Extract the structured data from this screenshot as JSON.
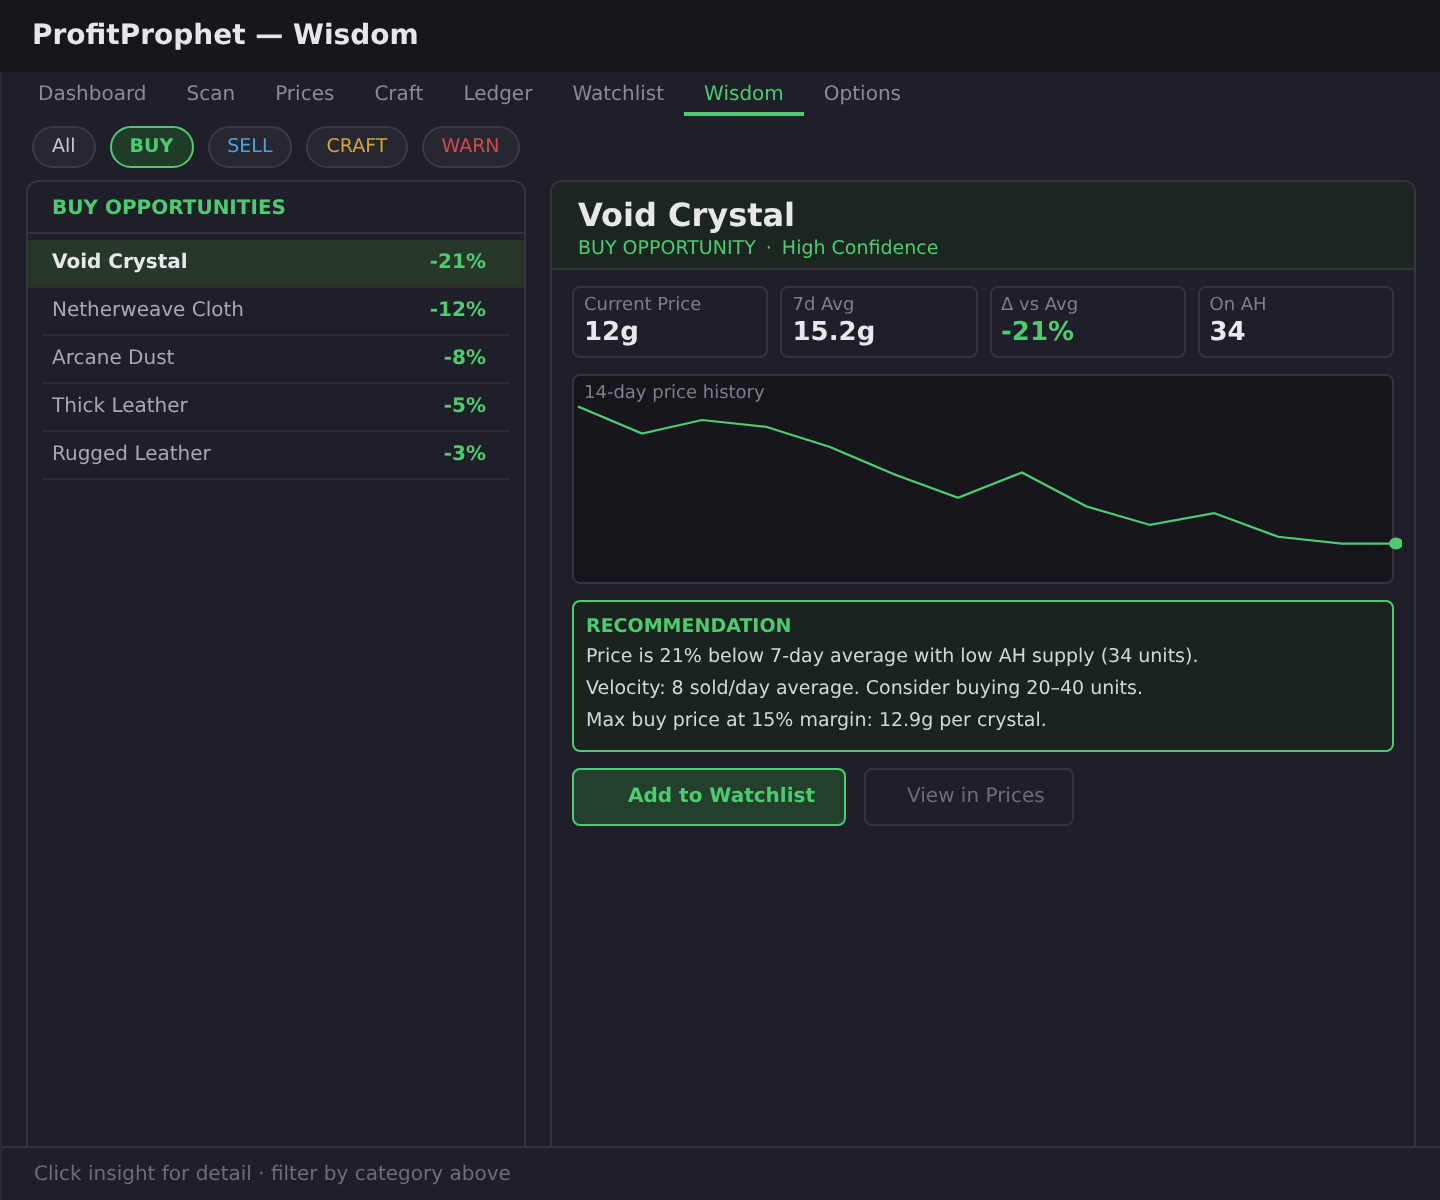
{
  "window": {
    "title": "ProfitProphet — Wisdom"
  },
  "tabs": [
    {
      "label": "Dashboard",
      "selected": false
    },
    {
      "label": "Scan",
      "selected": false
    },
    {
      "label": "Prices",
      "selected": false
    },
    {
      "label": "Craft",
      "selected": false
    },
    {
      "label": "Ledger",
      "selected": false
    },
    {
      "label": "Watchlist",
      "selected": false
    },
    {
      "label": "Wisdom",
      "selected": true
    },
    {
      "label": "Options",
      "selected": false
    }
  ],
  "filters": [
    {
      "label": "All",
      "kind": "all",
      "selected": false
    },
    {
      "label": "BUY",
      "kind": "buy",
      "selected": true
    },
    {
      "label": "SELL",
      "kind": "sell",
      "selected": false
    },
    {
      "label": "CRAFT",
      "kind": "craft",
      "selected": false
    },
    {
      "label": "WARN",
      "kind": "warn",
      "selected": false
    }
  ],
  "list": {
    "heading": "BUY OPPORTUNITIES",
    "items": [
      {
        "name": "Void Crystal",
        "change": "-21%",
        "selected": true
      },
      {
        "name": "Netherweave Cloth",
        "change": "-12%",
        "selected": false
      },
      {
        "name": "Arcane Dust",
        "change": "-8%",
        "selected": false
      },
      {
        "name": "Thick Leather",
        "change": "-5%",
        "selected": false
      },
      {
        "name": "Rugged Leather",
        "change": "-3%",
        "selected": false
      }
    ]
  },
  "detail": {
    "title": "Void Crystal",
    "category": "BUY OPPORTUNITY",
    "separator": "·",
    "confidence": "High Confidence",
    "stats": [
      {
        "label": "Current Price",
        "value": "12g",
        "kind": "plain"
      },
      {
        "label": "7d Avg",
        "value": "15.2g",
        "kind": "plain"
      },
      {
        "label": "Δ vs Avg",
        "value": "-21%",
        "kind": "good"
      },
      {
        "label": "On AH",
        "value": "34",
        "kind": "plain"
      }
    ],
    "chart": {
      "label": "14-day price history"
    },
    "recommendation": {
      "heading": "RECOMMENDATION",
      "lines": [
        "Price is 21% below 7-day average with low AH supply (34 units).",
        "Velocity: 8 sold/day average. Consider buying 20–40 units.",
        "Max buy price at 15% margin: 12.9g per crystal."
      ]
    },
    "buttons": [
      {
        "label": "Add to Watchlist",
        "kind": "primary"
      },
      {
        "label": "View in Prices",
        "kind": "secondary"
      }
    ]
  },
  "status_bar": {
    "text": "Click insight for detail · filter by category above"
  }
}
